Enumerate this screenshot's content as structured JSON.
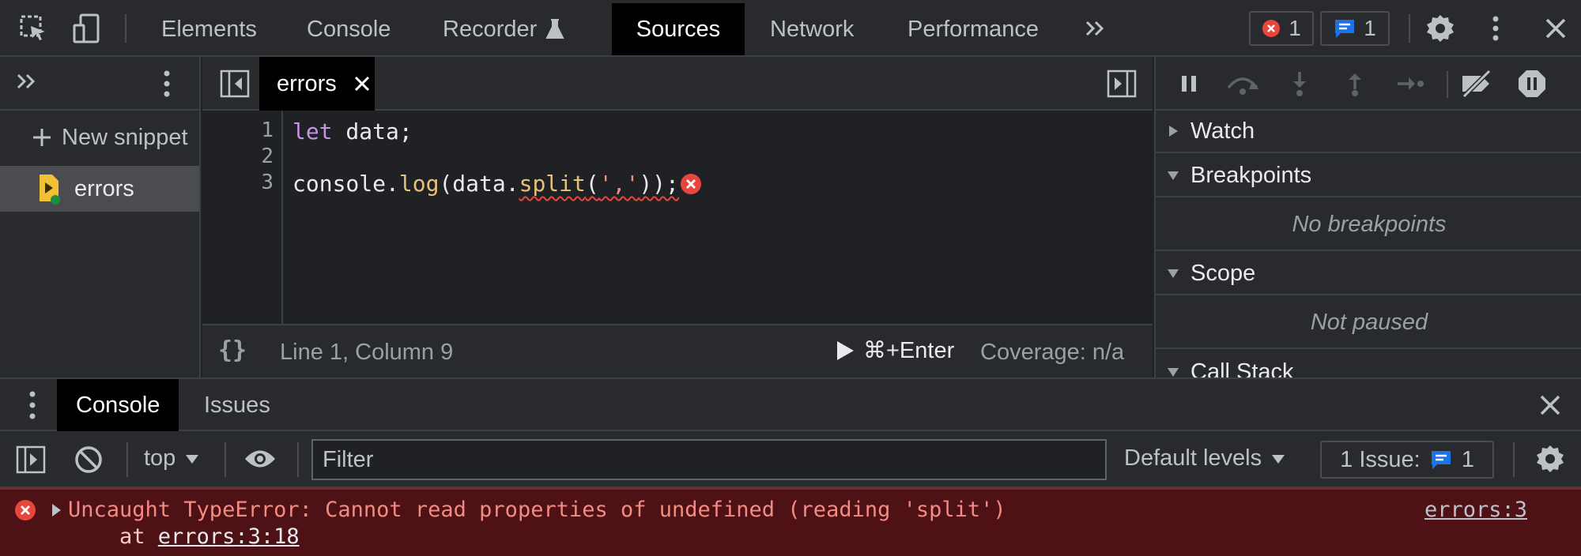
{
  "toolbar": {
    "tabs": [
      "Elements",
      "Console",
      "Recorder",
      "Sources",
      "Network",
      "Performance"
    ],
    "active_tab": "Sources",
    "error_count": "1",
    "message_count": "1"
  },
  "navigator": {
    "new_snippet_label": "New snippet",
    "snippets": [
      "errors"
    ]
  },
  "editor": {
    "file_tab": "errors",
    "line_numbers": [
      "1",
      "2",
      "3"
    ],
    "code": {
      "line1_kw": "let",
      "line1_rest": " data;",
      "line3_a": "console.",
      "line3_log": "log",
      "line3_b": "(data.",
      "line3_split": "split",
      "line3_c": "(",
      "line3_str": "','",
      "line3_d": "));"
    },
    "status": {
      "position": "Line 1, Column 9",
      "run_shortcut": "⌘+Enter",
      "coverage": "Coverage: n/a"
    }
  },
  "debugger": {
    "panes": {
      "watch": "Watch",
      "breakpoints": "Breakpoints",
      "breakpoints_empty": "No breakpoints",
      "scope": "Scope",
      "scope_empty": "Not paused",
      "call_stack": "Call Stack"
    }
  },
  "drawer": {
    "tabs": [
      "Console",
      "Issues"
    ],
    "active_tab": "Console"
  },
  "console": {
    "context": "top",
    "filter_placeholder": "Filter",
    "levels": "Default levels",
    "issues_label": "1 Issue:",
    "issues_count": "1",
    "error": {
      "message": "Uncaught TypeError: Cannot read properties of undefined (reading 'split')",
      "at_prefix": "    at ",
      "at_link": "errors:3:18",
      "source": "errors:3"
    }
  },
  "colors": {
    "error_red": "#e8453c",
    "info_blue": "#1a73e8",
    "panel_bg": "#292a2d",
    "editor_bg": "#202124",
    "error_row_bg": "#4e1116"
  }
}
